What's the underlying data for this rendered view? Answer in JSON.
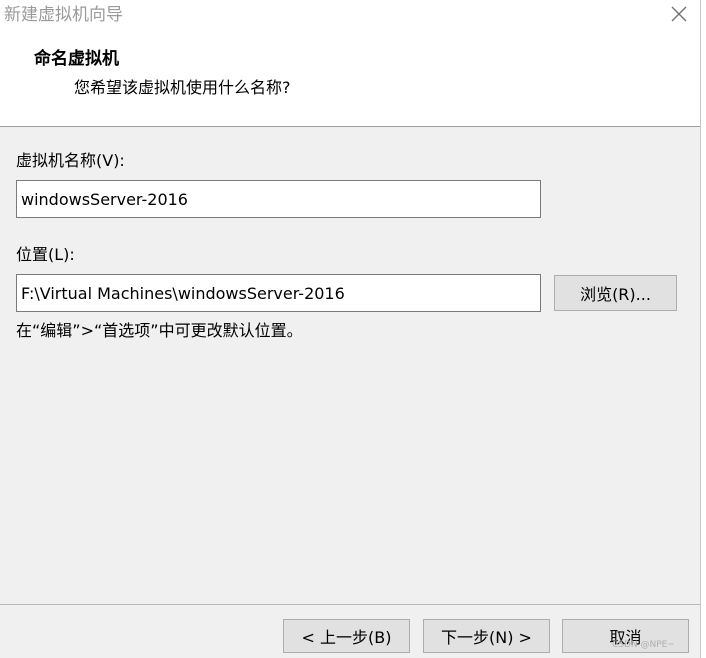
{
  "window": {
    "title": "新建虚拟机向导",
    "close_icon": "close-icon"
  },
  "header": {
    "title": "命名虚拟机",
    "subtitle": "您希望该虚拟机使用什么名称?"
  },
  "form": {
    "name_label": "虚拟机名称(V):",
    "name_value": "windowsServer-2016",
    "location_label": "位置(L):",
    "location_value": "F:\\Virtual Machines\\windowsServer-2016",
    "browse_label": "浏览(R)...",
    "hint": "在“编辑”>“首选项”中可更改默认位置。"
  },
  "footer": {
    "back_label": "< 上一步(B)",
    "next_label": "下一步(N) >",
    "cancel_label": "取消"
  },
  "watermark": "CSDN @NPE~"
}
